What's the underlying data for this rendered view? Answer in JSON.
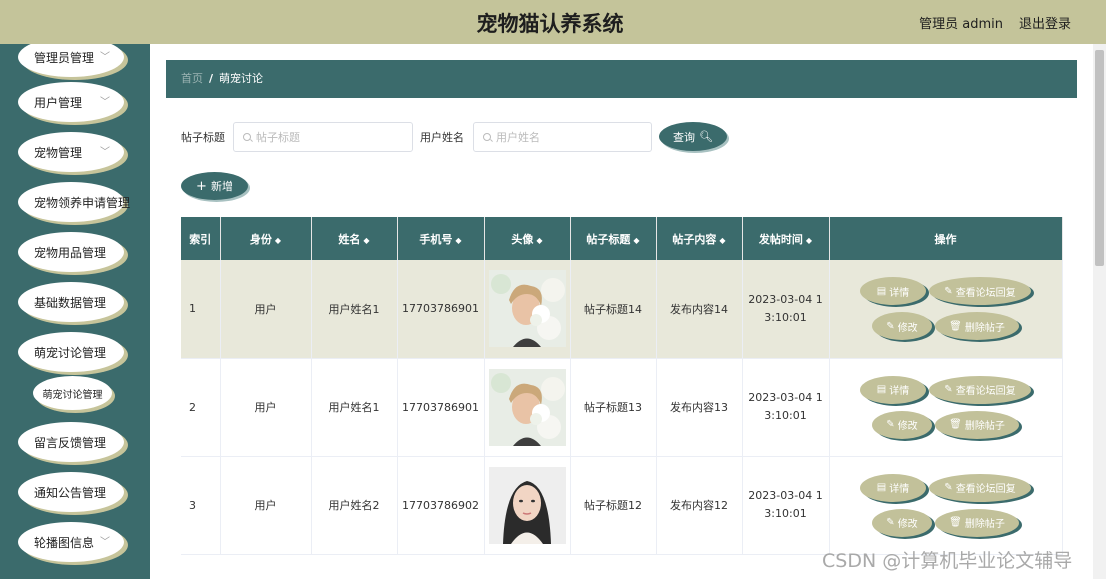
{
  "header": {
    "title": "宠物猫认养系统",
    "admin": "管理员 admin",
    "logout": "退出登录"
  },
  "sidebar": {
    "items": [
      {
        "label": "管理员管理",
        "chevron": true
      },
      {
        "label": "用户管理",
        "chevron": true
      },
      {
        "label": "宠物管理",
        "chevron": true
      },
      {
        "label": "宠物领养申请管理",
        "chevron": false
      },
      {
        "label": "宠物用品管理",
        "chevron": false
      },
      {
        "label": "基础数据管理",
        "chevron": false
      },
      {
        "label": "萌宠讨论管理",
        "chevron": false
      },
      {
        "label": "留言反馈管理",
        "chevron": false
      },
      {
        "label": "通知公告管理",
        "chevron": false
      },
      {
        "label": "轮播图信息",
        "chevron": true
      }
    ],
    "sub_item": "萌宠讨论管理"
  },
  "breadcrumb": {
    "home": "首页",
    "separator": "/",
    "current": "萌宠讨论"
  },
  "search": {
    "title_label": "帖子标题",
    "title_placeholder": "帖子标题",
    "name_label": "用户姓名",
    "name_placeholder": "用户姓名",
    "button": "查询"
  },
  "add_button": "新增",
  "table": {
    "headers": [
      "索引",
      "身份",
      "姓名",
      "手机号",
      "头像",
      "帖子标题",
      "帖子内容",
      "发帖时间",
      "操作"
    ],
    "rows": [
      {
        "index": "1",
        "role": "用户",
        "name": "用户姓名1",
        "phone": "17703786901",
        "title": "帖子标题14",
        "content": "发布内容14",
        "time1": "2023-03-04 1",
        "time2": "3:10:01",
        "avatar": "man"
      },
      {
        "index": "2",
        "role": "用户",
        "name": "用户姓名1",
        "phone": "17703786901",
        "title": "帖子标题13",
        "content": "发布内容13",
        "time1": "2023-03-04 1",
        "time2": "3:10:01",
        "avatar": "man"
      },
      {
        "index": "3",
        "role": "用户",
        "name": "用户姓名2",
        "phone": "17703786902",
        "title": "帖子标题12",
        "content": "发布内容12",
        "time1": "2023-03-04 1",
        "time2": "3:10:01",
        "avatar": "woman"
      }
    ],
    "actions": {
      "detail": "详情",
      "replies": "查看论坛回复",
      "edit": "修改",
      "delete": "删除帖子"
    }
  },
  "watermark": "CSDN @计算机毕业论文辅导"
}
